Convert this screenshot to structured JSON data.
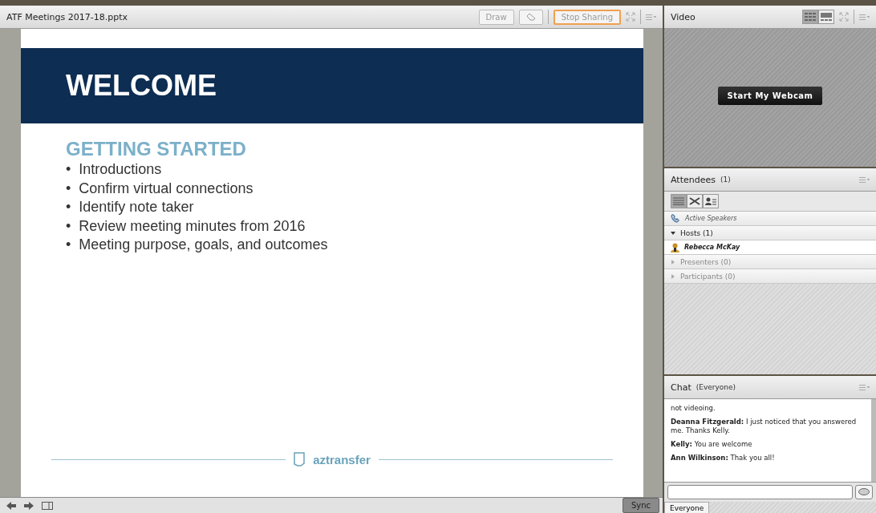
{
  "share_pod": {
    "title": "ATF Meetings 2017-18.pptx",
    "toolbar": [
      {
        "kind": "button",
        "label": "Draw",
        "highlighted": false
      },
      {
        "kind": "icon",
        "highlighted": false
      },
      {
        "kind": "button",
        "label": "Stop Sharing",
        "highlighted": true
      }
    ],
    "slide": {
      "banner": "WELCOME",
      "heading": "GETTING STARTED",
      "bullet_mark": "•",
      "bullets": [
        "Introductions",
        "Confirm virtual connections",
        "Identify note taker",
        "Review meeting minutes from 2016",
        "Meeting purpose, goals, and outcomes"
      ],
      "logo": "aztransfer"
    },
    "footer": {
      "sync": "Sync"
    }
  },
  "video_pod": {
    "title": "Video",
    "layouts": [
      {
        "selected": true
      },
      {
        "selected": false
      }
    ],
    "webcam_button": "Start My Webcam"
  },
  "attendees_pod": {
    "title": "Attendees",
    "count": "(1)",
    "views": [
      {
        "selected": true
      },
      {
        "selected": false
      },
      {
        "selected": false
      }
    ],
    "active_speakers": "Active Speakers",
    "groups": [
      {
        "label": "Hosts (1)",
        "expanded": true,
        "members": [
          "Rebecca McKay"
        ]
      },
      {
        "label": "Presenters (0)",
        "expanded": false
      },
      {
        "label": "Participants (0)",
        "expanded": false
      }
    ]
  },
  "chat_pod": {
    "title": "Chat",
    "audience": "(Everyone)",
    "messages": [
      "not videoing.",
      "**Deanna Fitzgerald:** I just noticed that you answered me. Thanks Kelly.",
      "**Kelly:** You are welcome",
      "**Ann Wilkinson:** Thak you all!"
    ],
    "tab": "Everyone"
  }
}
